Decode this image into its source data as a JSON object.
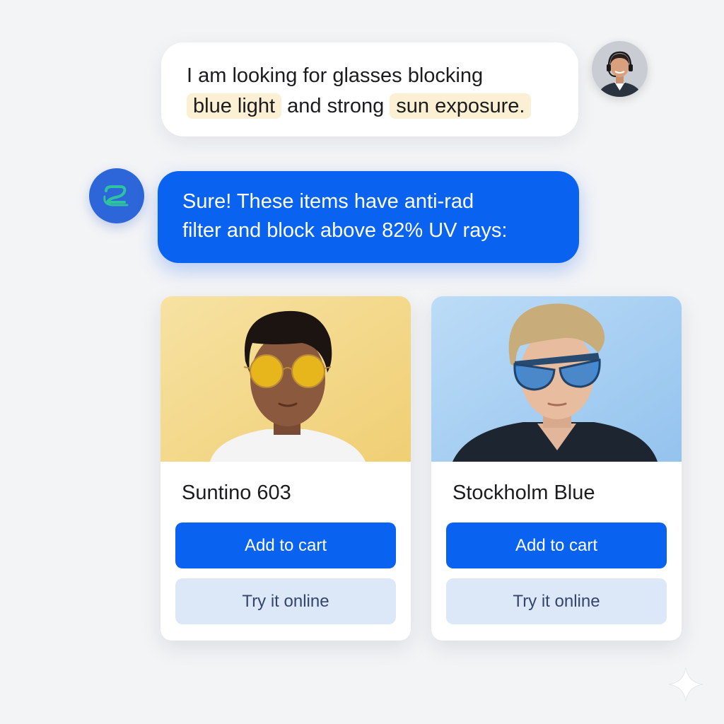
{
  "user_message": {
    "line1": "I am looking for glasses blocking",
    "highlight1": "blue light",
    "connector": "and strong",
    "highlight2": "sun exposure."
  },
  "bot_message": {
    "line1": "Sure! These items have anti-rad",
    "line2": "filter and block above 82% UV rays:"
  },
  "products": [
    {
      "name": "Suntino 603",
      "add_to_cart_label": "Add to cart",
      "try_online_label": "Try it online",
      "background_color": "#f5d98c",
      "lens_color": "#f2c21a"
    },
    {
      "name": "Stockholm Blue",
      "add_to_cart_label": "Add to cart",
      "try_online_label": "Try it online",
      "background_color": "#a9d0f3",
      "lens_color": "#2f7fd1"
    }
  ],
  "colors": {
    "accent": "#0a63f0",
    "secondary_button": "#dce8f8",
    "highlight": "#fbf0d3",
    "page_background": "#f3f4f6"
  },
  "icons": {
    "user_avatar": "person-with-headset-avatar",
    "bot_avatar": "assistant-logo-icon",
    "sparkle": "sparkle-icon"
  }
}
